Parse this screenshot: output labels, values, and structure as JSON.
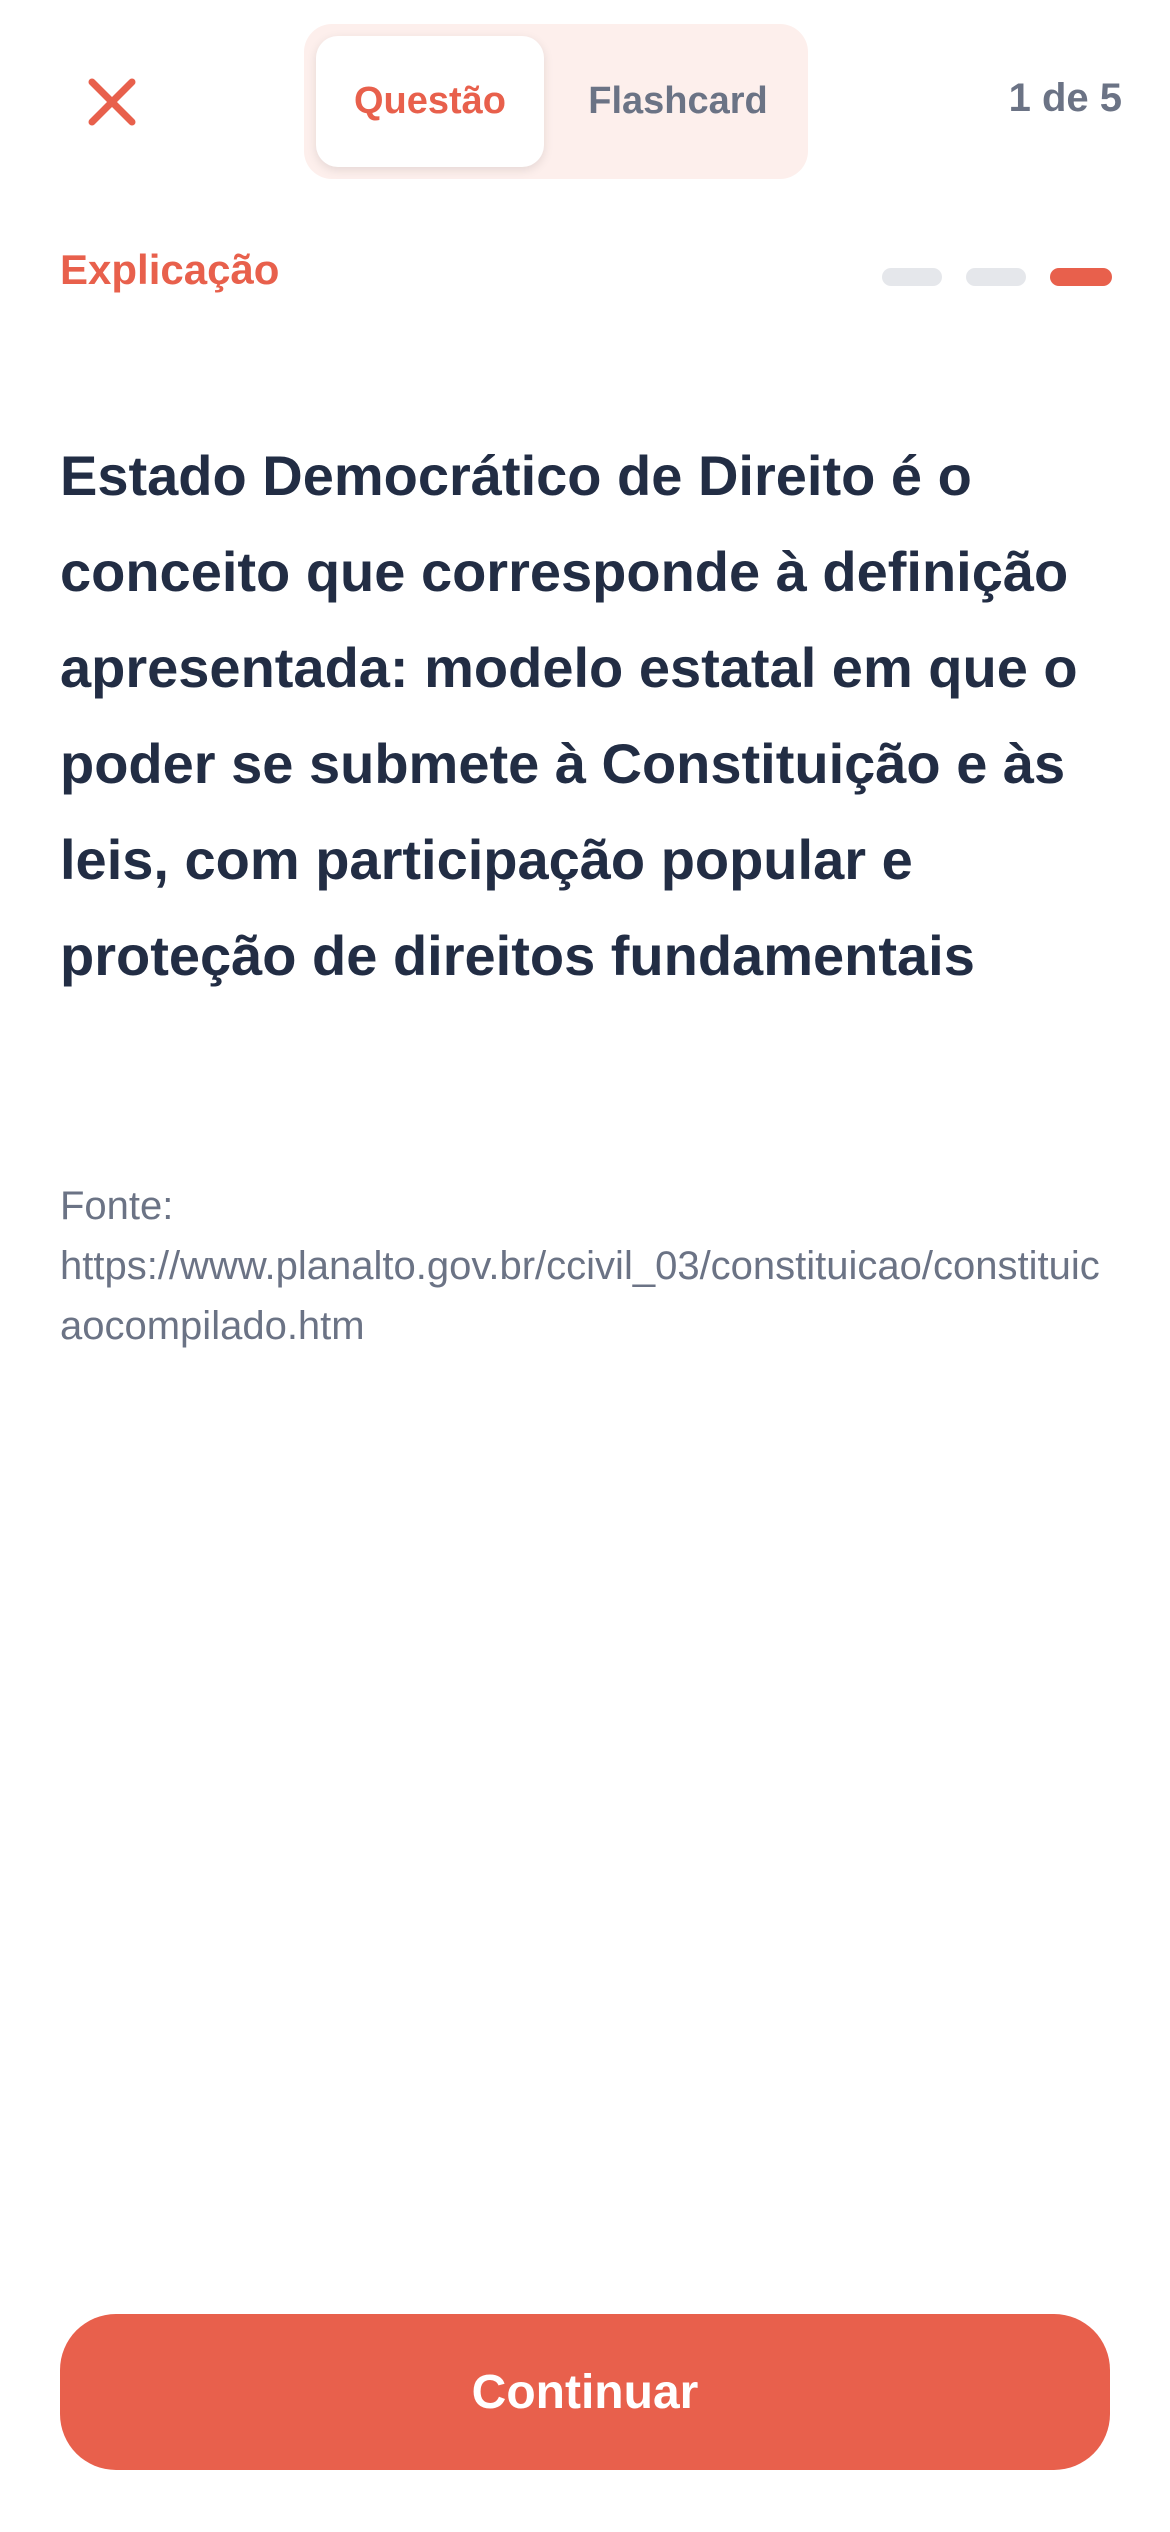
{
  "header": {
    "close_icon": "close-icon",
    "tabs": [
      {
        "label": "Questão",
        "active": true
      },
      {
        "label": "Flashcard",
        "active": false
      }
    ],
    "counter": "1 de 5"
  },
  "section": {
    "label": "Explicação",
    "progress": {
      "total_steps": 3,
      "current_step": 3
    }
  },
  "content": {
    "explanation": "Estado Democrático de Direito é o conceito que corresponde à definição apresentada: modelo estatal em que o poder se submete à Constituição e às leis, com participação popular e proteção de direitos fundamentais",
    "source_label": "Fonte:",
    "source_url": "https://www.planalto.gov.br/ccivil_03/constituicao/constituicaocompilado.htm"
  },
  "footer": {
    "continue_label": "Continuar"
  },
  "colors": {
    "accent": "#e8604c",
    "text_dark": "#222d44",
    "text_muted": "#6b7385",
    "segment_bg": "#fdefec",
    "progress_inactive": "#e5e7eb"
  }
}
